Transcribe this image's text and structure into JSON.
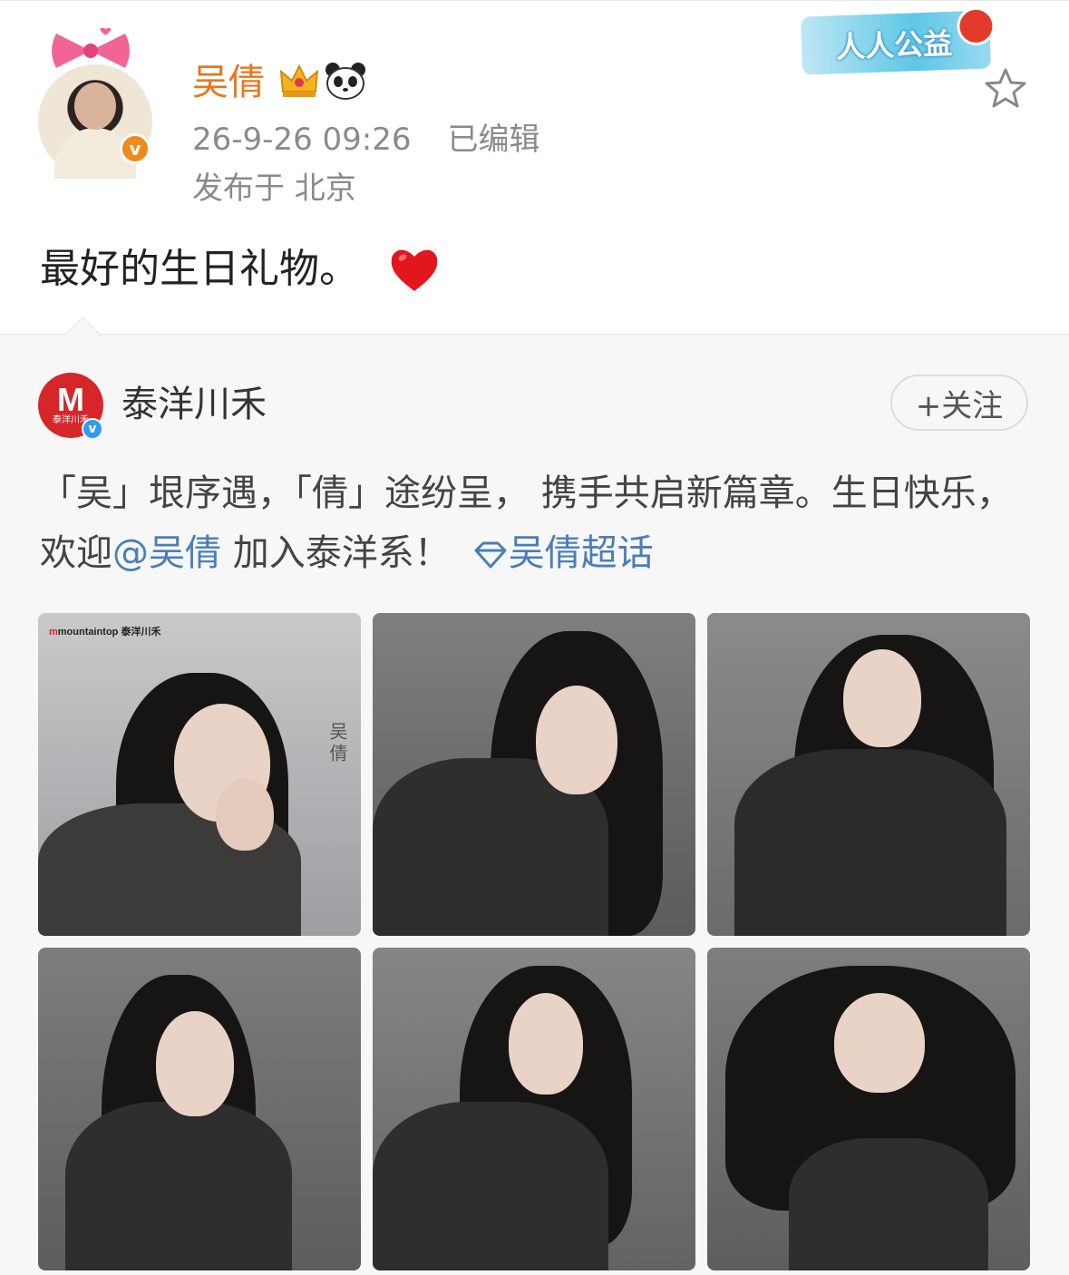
{
  "post": {
    "username": "吴倩",
    "timestamp": "26-9-26 09:26",
    "edited_label": "已编辑",
    "location": "发布于 北京",
    "text": "最好的生日礼物。",
    "charity_badge": "人人公益",
    "icons": [
      "crown-icon",
      "panda-icon",
      "heart-icon",
      "star-icon",
      "verified-icon"
    ]
  },
  "repost": {
    "org_name": "泰洋川禾",
    "org_avatar_letter": "M",
    "org_avatar_sub": "泰洋川禾",
    "follow_label": "+关注",
    "text_part1": "「吴」垠序遇，「倩」途纷呈， 携手共启新篇章。生日快乐，欢迎",
    "mention": "@吴倩",
    "text_part2": " 加入泰洋系！",
    "topic": "吴倩超话",
    "photo_watermark_brand": "mountaintop",
    "photo_watermark_sub": "泰洋川禾",
    "photo_vertical_name": "吴倩"
  },
  "colors": {
    "username": "#e8761f",
    "link": "#4a7fb5",
    "verified_orange": "#f08a1d",
    "verified_blue": "#2f9bf0",
    "brand_red": "#d6262a"
  }
}
